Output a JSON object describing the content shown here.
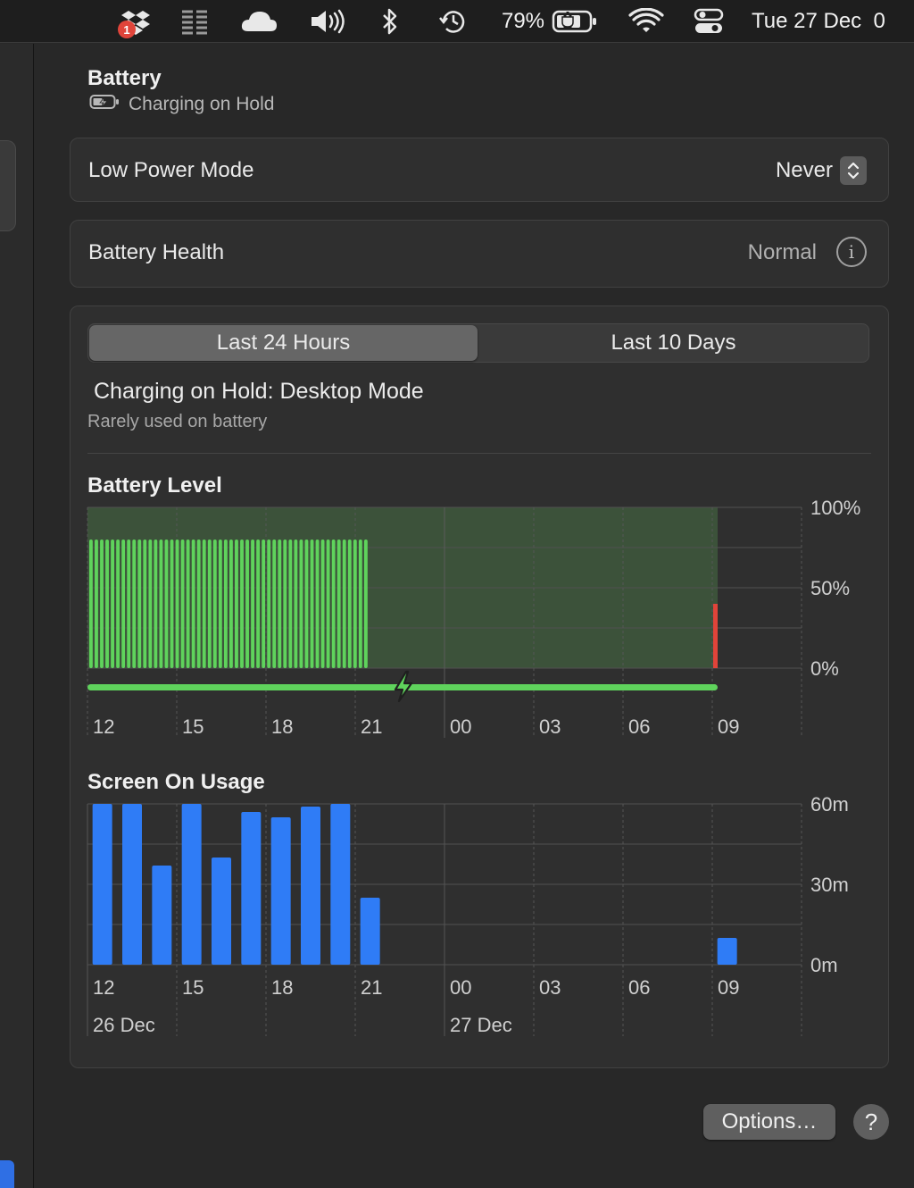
{
  "menubar": {
    "dropbox_badge": "1",
    "battery_percent": "79%",
    "clock": "Tue 27 Dec  0"
  },
  "header": {
    "title": "Battery",
    "subtitle": "Charging on Hold"
  },
  "low_power": {
    "label": "Low Power Mode",
    "value": "Never"
  },
  "health": {
    "label": "Battery Health",
    "value": "Normal"
  },
  "tabs": [
    {
      "label": "Last 24 Hours",
      "active": true
    },
    {
      "label": "Last 10 Days",
      "active": false
    }
  ],
  "status": {
    "title": "Charging on Hold: Desktop Mode",
    "subtitle": "Rarely used on battery"
  },
  "colors": {
    "battery_green": "#5fd35c",
    "charging_bg": "#3c523a",
    "low_red": "#e0443a",
    "usage_blue": "#2f7cf6"
  },
  "chart_data": [
    {
      "type": "bar",
      "title": "Battery Level",
      "ylim": [
        0,
        100
      ],
      "y_ticks": [
        "100%",
        "50%",
        "0%"
      ],
      "x_ticks": [
        "12",
        "15",
        "18",
        "21",
        "00",
        "03",
        "06",
        "09"
      ],
      "bar_count": 52,
      "level_values": [
        80,
        80,
        80,
        80,
        80,
        80,
        80,
        80,
        80,
        80,
        80,
        80,
        80,
        80,
        80,
        80,
        80,
        80,
        80,
        80,
        80,
        80,
        80,
        80,
        80,
        80,
        80,
        80,
        80,
        80,
        80,
        80,
        80,
        80,
        80,
        80,
        80,
        80,
        80,
        80,
        80,
        80,
        80,
        80,
        80,
        80,
        80,
        80,
        80,
        80,
        80,
        80
      ],
      "final_reading": 40,
      "charging_indicator": true
    },
    {
      "type": "bar",
      "title": "Screen On Usage",
      "ylim": [
        0,
        60
      ],
      "y_ticks": [
        "60m",
        "30m",
        "0m"
      ],
      "x_ticks": [
        "12",
        "15",
        "18",
        "21",
        "00",
        "03",
        "06",
        "09"
      ],
      "date_labels": [
        "26 Dec",
        "27 Dec"
      ],
      "categories": [
        "12",
        "13",
        "14",
        "15",
        "16",
        "17",
        "18",
        "19",
        "20",
        "21",
        "09"
      ],
      "values": [
        60,
        60,
        37,
        60,
        40,
        57,
        55,
        59,
        60,
        25,
        10
      ]
    }
  ],
  "footer": {
    "options_label": "Options…",
    "help_label": "?"
  }
}
